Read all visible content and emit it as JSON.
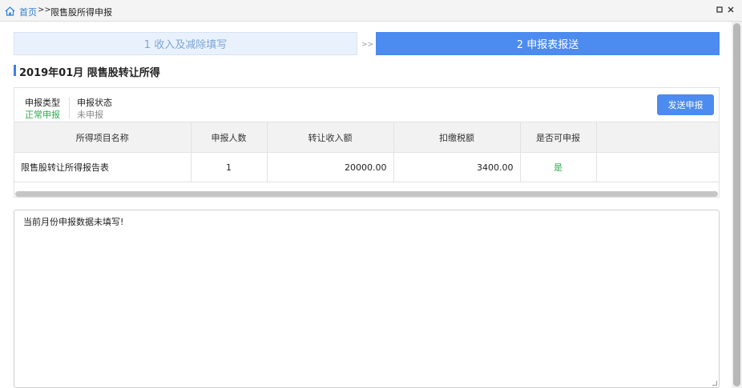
{
  "breadcrumb": {
    "home": "首页",
    "separator": ">>",
    "current": "限售股所得申报"
  },
  "window": {
    "restore_icon": "restore-icon",
    "close_icon": "close-icon"
  },
  "steps": [
    {
      "label": "1 收入及减除填写",
      "active": false
    },
    {
      "label": "2 申报表报送",
      "active": true
    }
  ],
  "step_arrow": ">>",
  "section": {
    "title": "2019年01月   限售股转让所得"
  },
  "declaration": {
    "type_label": "申报类型",
    "type_value": "正常申报",
    "status_label": "申报状态",
    "status_value": "未申报",
    "send_button": "发送申报"
  },
  "table": {
    "headers": [
      "所得项目名称",
      "申报人数",
      "转让收入额",
      "扣缴税额",
      "是否可申报",
      ""
    ],
    "rows": [
      [
        "限售股转让所得报告表",
        "1",
        "20000.00",
        "3400.00",
        "是",
        ""
      ]
    ]
  },
  "message": "当前月份申报数据未填写!",
  "colors": {
    "accent": "#4c8bef",
    "success": "#2fa84f",
    "link": "#2b7fd9"
  }
}
